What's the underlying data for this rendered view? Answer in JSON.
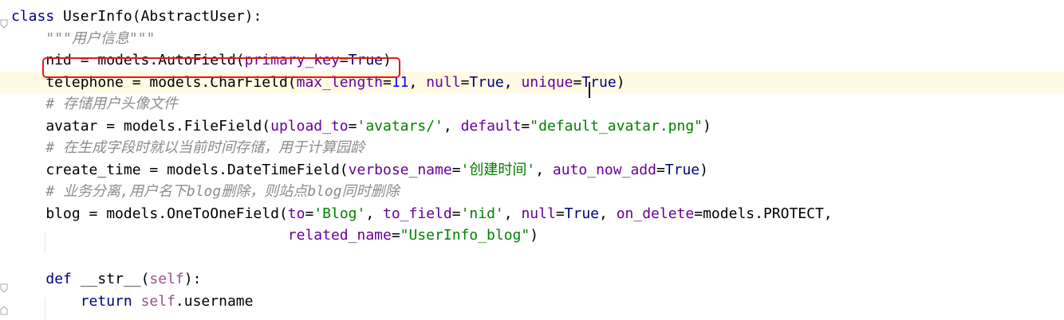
{
  "editor": {
    "language": "python",
    "current_line_index": 3,
    "lines": [
      {
        "segments": [
          {
            "t": "class ",
            "c": "kw"
          },
          {
            "t": "UserInfo(AbstractUser):",
            "c": "plain"
          }
        ]
      },
      {
        "segments": [
          {
            "t": "    ",
            "c": "plain"
          },
          {
            "t": "\"\"\"用户信息\"\"\"",
            "c": "docstr"
          }
        ]
      },
      {
        "segments": [
          {
            "t": "    nid = models.AutoField(",
            "c": "plain"
          },
          {
            "t": "primary_key",
            "c": "param"
          },
          {
            "t": "=",
            "c": "plain"
          },
          {
            "t": "True",
            "c": "builtin"
          },
          {
            "t": ")",
            "c": "plain"
          }
        ]
      },
      {
        "segments": [
          {
            "t": "    telephone = models.CharField(",
            "c": "plain"
          },
          {
            "t": "max_length",
            "c": "param"
          },
          {
            "t": "=",
            "c": "plain"
          },
          {
            "t": "11",
            "c": "num"
          },
          {
            "t": ", ",
            "c": "plain"
          },
          {
            "t": "null",
            "c": "param"
          },
          {
            "t": "=",
            "c": "plain"
          },
          {
            "t": "True",
            "c": "builtin"
          },
          {
            "t": ", ",
            "c": "plain"
          },
          {
            "t": "unique",
            "c": "param"
          },
          {
            "t": "=",
            "c": "plain"
          },
          {
            "t": "True",
            "c": "builtin"
          },
          {
            "t": ")",
            "c": "plain"
          }
        ]
      },
      {
        "segments": [
          {
            "t": "    ",
            "c": "plain"
          },
          {
            "t": "# 存储用户头像文件",
            "c": "comment"
          }
        ]
      },
      {
        "segments": [
          {
            "t": "    avatar = models.FileField(",
            "c": "plain"
          },
          {
            "t": "upload_to",
            "c": "param"
          },
          {
            "t": "=",
            "c": "plain"
          },
          {
            "t": "'avatars/'",
            "c": "str"
          },
          {
            "t": ", ",
            "c": "plain"
          },
          {
            "t": "default",
            "c": "param"
          },
          {
            "t": "=",
            "c": "plain"
          },
          {
            "t": "\"default_avatar.png\"",
            "c": "str"
          },
          {
            "t": ")",
            "c": "plain"
          }
        ]
      },
      {
        "segments": [
          {
            "t": "    ",
            "c": "plain"
          },
          {
            "t": "# 在生成字段时就以当前时间存储，用于计算园龄",
            "c": "comment"
          }
        ]
      },
      {
        "segments": [
          {
            "t": "    create_time = models.DateTimeField(",
            "c": "plain"
          },
          {
            "t": "verbose_name",
            "c": "param"
          },
          {
            "t": "=",
            "c": "plain"
          },
          {
            "t": "'创建时间'",
            "c": "str"
          },
          {
            "t": ", ",
            "c": "plain"
          },
          {
            "t": "auto_now_add",
            "c": "param"
          },
          {
            "t": "=",
            "c": "plain"
          },
          {
            "t": "True",
            "c": "builtin"
          },
          {
            "t": ")",
            "c": "plain"
          }
        ]
      },
      {
        "segments": [
          {
            "t": "    ",
            "c": "plain"
          },
          {
            "t": "# 业务分离,用户名下blog删除，则站点blog同时删除",
            "c": "comment"
          }
        ]
      },
      {
        "segments": [
          {
            "t": "    blog = models.OneToOneField(",
            "c": "plain"
          },
          {
            "t": "to",
            "c": "param"
          },
          {
            "t": "=",
            "c": "plain"
          },
          {
            "t": "'Blog'",
            "c": "str"
          },
          {
            "t": ", ",
            "c": "plain"
          },
          {
            "t": "to_field",
            "c": "param"
          },
          {
            "t": "=",
            "c": "plain"
          },
          {
            "t": "'nid'",
            "c": "str"
          },
          {
            "t": ", ",
            "c": "plain"
          },
          {
            "t": "null",
            "c": "param"
          },
          {
            "t": "=",
            "c": "plain"
          },
          {
            "t": "True",
            "c": "builtin"
          },
          {
            "t": ", ",
            "c": "plain"
          },
          {
            "t": "on_delete",
            "c": "param"
          },
          {
            "t": "=",
            "c": "plain"
          },
          {
            "t": "models.PROTECT,",
            "c": "plain"
          }
        ]
      },
      {
        "segments": [
          {
            "t": "                                ",
            "c": "plain"
          },
          {
            "t": "related_name",
            "c": "param"
          },
          {
            "t": "=",
            "c": "plain"
          },
          {
            "t": "\"UserInfo_blog\"",
            "c": "str"
          },
          {
            "t": ")",
            "c": "plain"
          }
        ]
      },
      {
        "segments": []
      },
      {
        "segments": [
          {
            "t": "    ",
            "c": "plain"
          },
          {
            "t": "def ",
            "c": "kw"
          },
          {
            "t": "__str__",
            "c": "plain"
          },
          {
            "t": "(",
            "c": "plain"
          },
          {
            "t": "self",
            "c": "selfkw"
          },
          {
            "t": "):",
            "c": "plain"
          }
        ]
      },
      {
        "segments": [
          {
            "t": "        ",
            "c": "plain"
          },
          {
            "t": "return ",
            "c": "kw"
          },
          {
            "t": "self",
            "c": "selfkw"
          },
          {
            "t": ".username",
            "c": "plain"
          }
        ]
      }
    ]
  },
  "annotations": {
    "highlight_color": "#e01b1b",
    "highlighted_line_index": 2
  },
  "colors": {
    "keyword": "#000080",
    "param": "#660099",
    "string": "#008000",
    "number": "#0000ff",
    "comment": "#8c8c8c",
    "self": "#94558d",
    "current_line_bg": "#fffae3"
  }
}
